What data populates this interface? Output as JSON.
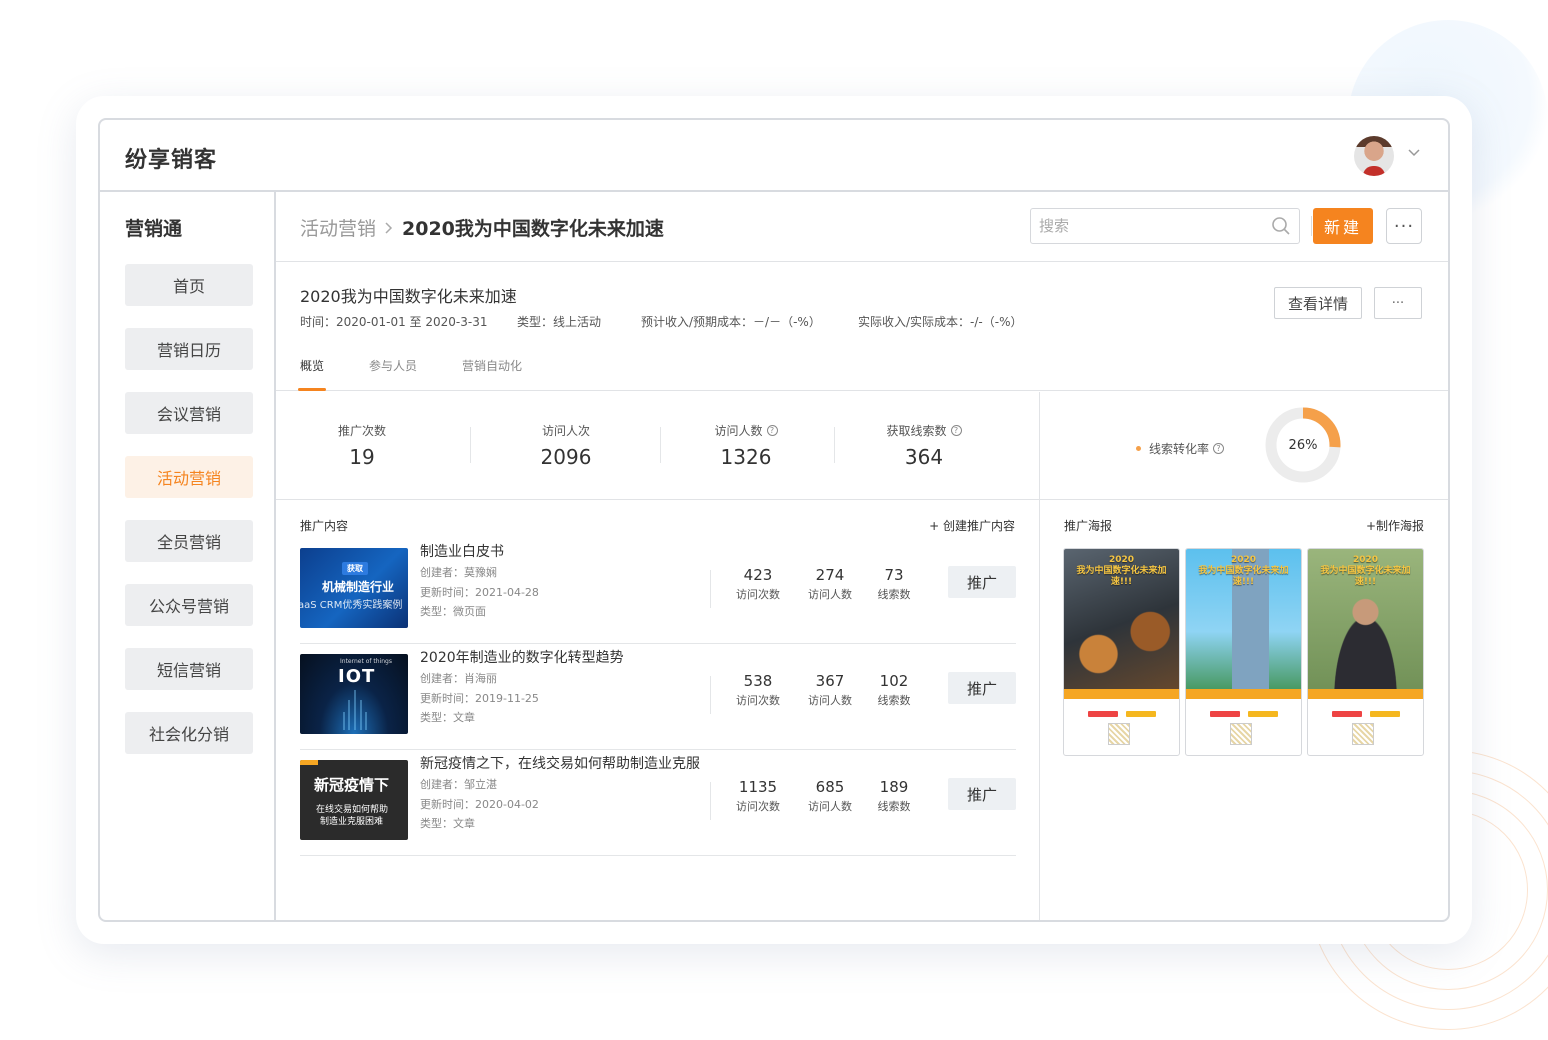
{
  "app": {
    "title": "纷享销客"
  },
  "sidebar": {
    "title": "营销通",
    "items": [
      {
        "label": "首页",
        "active": false
      },
      {
        "label": "营销日历",
        "active": false
      },
      {
        "label": "会议营销",
        "active": false
      },
      {
        "label": "活动营销",
        "active": true
      },
      {
        "label": "全员营销",
        "active": false
      },
      {
        "label": "公众号营销",
        "active": false
      },
      {
        "label": "短信营销",
        "active": false
      },
      {
        "label": "社会化分销",
        "active": false
      }
    ]
  },
  "header": {
    "breadcrumb_parent": "活动营销",
    "breadcrumb_current": "2020我为中国数字化未来加速",
    "search_placeholder": "搜索",
    "new_button": "新建",
    "more_button": "···"
  },
  "activity": {
    "title": "2020我为中国数字化未来加速",
    "time": "时间：2020-01-01 至 2020-3-31",
    "type": "类型：线上活动",
    "expected": "预计收入/预期成本：－/－（-%）",
    "actual": "实际收入/实际成本：-/-（-%）",
    "detail_button": "查看详情",
    "detail_more": "···",
    "tabs": [
      {
        "label": "概览",
        "active": true
      },
      {
        "label": "参与人员",
        "active": false
      },
      {
        "label": "营销自动化",
        "active": false
      }
    ]
  },
  "stats": [
    {
      "label": "推广次数",
      "value": "19",
      "help": false
    },
    {
      "label": "访问人次",
      "value": "2096",
      "help": false
    },
    {
      "label": "访问人数",
      "value": "1326",
      "help": true
    },
    {
      "label": "获取线索数",
      "value": "364",
      "help": true
    }
  ],
  "conversion": {
    "label": "线索转化率",
    "value_text": "26%",
    "value": 0.26,
    "color": "#f5a04a",
    "track": "#ececec"
  },
  "content": {
    "title": "推广内容",
    "create_link": "+ 创建推广内容",
    "items": [
      {
        "title": "制造业白皮书",
        "creator": "创建者：莫豫娴",
        "updated": "更新时间：2021-04-28",
        "type": "类型：微页面",
        "thumb_text": "机械制造行业",
        "thumb_sub": "aaS CRM优秀实践案例",
        "thumb_tag": "获取",
        "visits": "423",
        "visitors": "274",
        "leads": "73",
        "visits_label": "访问次数",
        "visitors_label": "访问人数",
        "leads_label": "线索数",
        "button": "推广"
      },
      {
        "title": "2020年制造业的数字化转型趋势",
        "creator": "创建者：肖海丽",
        "updated": "更新时间：2019-11-25",
        "type": "类型：文章",
        "thumb_text": "IOT",
        "thumb_sub": "Internet of things",
        "visits": "538",
        "visitors": "367",
        "leads": "102",
        "visits_label": "访问次数",
        "visitors_label": "访问人数",
        "leads_label": "线索数",
        "button": "推广"
      },
      {
        "title": "新冠疫情之下，在线交易如何帮助制造业克服",
        "creator": "创建者：邹立湛",
        "updated": "更新时间：2020-04-02",
        "type": "类型：文章",
        "thumb_text": "新冠疫情下",
        "thumb_sub": "在线交易如何帮助",
        "thumb_sub2": "制造业克服困难",
        "visits": "1135",
        "visitors": "685",
        "leads": "189",
        "visits_label": "访问次数",
        "visitors_label": "访问人数",
        "leads_label": "线索数",
        "button": "推广"
      }
    ]
  },
  "posters": {
    "title": "推广海报",
    "create_link": "+制作海报",
    "items": [
      {
        "year": "2020",
        "headline": "我为中国数字化未来加速!!!"
      },
      {
        "year": "2020",
        "headline": "我为中国数字化未来加速!!!"
      },
      {
        "year": "2020",
        "headline": "我为中国数字化未来加速!!!"
      }
    ]
  },
  "colors": {
    "accent": "#f5841f",
    "active_nav_bg": "#fdf1e6"
  }
}
